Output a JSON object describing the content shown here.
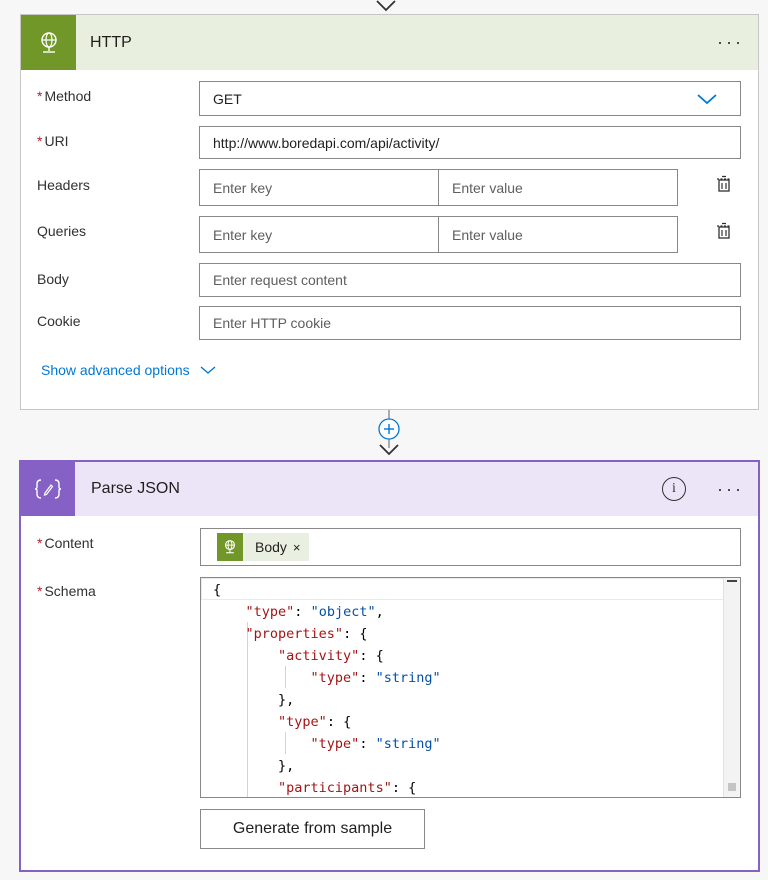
{
  "http_card": {
    "title": "HTTP",
    "icon": "globe-icon",
    "more": "···",
    "method": {
      "label": "Method",
      "value": "GET"
    },
    "uri": {
      "label": "URI",
      "value": "http://www.boredapi.com/api/activity/"
    },
    "headers": {
      "label": "Headers",
      "key_placeholder": "Enter key",
      "value_placeholder": "Enter value"
    },
    "queries": {
      "label": "Queries",
      "key_placeholder": "Enter key",
      "value_placeholder": "Enter value"
    },
    "body": {
      "label": "Body",
      "placeholder": "Enter request content"
    },
    "cookie": {
      "label": "Cookie",
      "placeholder": "Enter HTTP cookie"
    },
    "advanced": "Show advanced options",
    "required_mark": "*"
  },
  "parse_card": {
    "title": "Parse JSON",
    "icon": "parse-json-icon",
    "info": "i",
    "more": "···",
    "content": {
      "label": "Content",
      "token_label": "Body",
      "token_remove": "×"
    },
    "schema": {
      "label": "Schema"
    },
    "generate_label": "Generate from sample",
    "required_mark": "*"
  },
  "schema_lines": [
    [
      [
        "p",
        "{"
      ]
    ],
    [
      [
        "p",
        "    "
      ],
      [
        "k",
        "\"type\""
      ],
      [
        "p",
        ": "
      ],
      [
        "s",
        "\"object\""
      ],
      [
        "p",
        ","
      ]
    ],
    [
      [
        "p",
        "    "
      ],
      [
        "k",
        "\"properties\""
      ],
      [
        "p",
        ": {"
      ]
    ],
    [
      [
        "p",
        "        "
      ],
      [
        "k",
        "\"activity\""
      ],
      [
        "p",
        ": {"
      ]
    ],
    [
      [
        "p",
        "            "
      ],
      [
        "k",
        "\"type\""
      ],
      [
        "p",
        ": "
      ],
      [
        "s",
        "\"string\""
      ]
    ],
    [
      [
        "p",
        "        },"
      ]
    ],
    [
      [
        "p",
        "        "
      ],
      [
        "k",
        "\"type\""
      ],
      [
        "p",
        ": {"
      ]
    ],
    [
      [
        "p",
        "            "
      ],
      [
        "k",
        "\"type\""
      ],
      [
        "p",
        ": "
      ],
      [
        "s",
        "\"string\""
      ]
    ],
    [
      [
        "p",
        "        },"
      ]
    ],
    [
      [
        "p",
        "        "
      ],
      [
        "k",
        "\"participants\""
      ],
      [
        "p",
        ": {"
      ]
    ]
  ],
  "colors": {
    "http_accent": "#709727",
    "parse_accent": "#8661c5",
    "link": "#0078d4",
    "required": "#a4262c"
  }
}
